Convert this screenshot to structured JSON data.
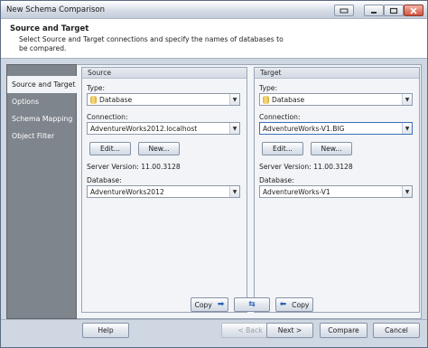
{
  "window": {
    "title": "New Schema Comparison"
  },
  "header": {
    "title": "Source and Target",
    "description": "Select Source and Target connections and specify the names of databases to be compared."
  },
  "nav": {
    "items": [
      {
        "label": "Source and Target",
        "selected": true
      },
      {
        "label": "Options",
        "selected": false
      },
      {
        "label": "Schema Mapping",
        "selected": false
      },
      {
        "label": "Object Filter",
        "selected": false
      }
    ]
  },
  "source": {
    "header": "Source",
    "type_label": "Type:",
    "type_value": "Database",
    "connection_label": "Connection:",
    "connection_value": "AdventureWorks2012.localhost",
    "edit_label": "Edit...",
    "new_label": "New...",
    "server_version": "Server Version: 11.00.3128",
    "database_label": "Database:",
    "database_value": "AdventureWorks2012"
  },
  "target": {
    "header": "Target",
    "type_label": "Type:",
    "type_value": "Database",
    "connection_label": "Connection:",
    "connection_value": "AdventureWorks-V1.BIG",
    "edit_label": "Edit...",
    "new_label": "New...",
    "server_version": "Server Version: 11.00.3128",
    "database_label": "Database:",
    "database_value": "AdventureWorks-V1"
  },
  "copy_bar": {
    "copy_right_label": "Copy",
    "copy_left_label": "Copy"
  },
  "footer": {
    "help_label": "Help",
    "back_label": "< Back",
    "next_label": "Next >",
    "compare_label": "Compare",
    "cancel_label": "Cancel"
  }
}
